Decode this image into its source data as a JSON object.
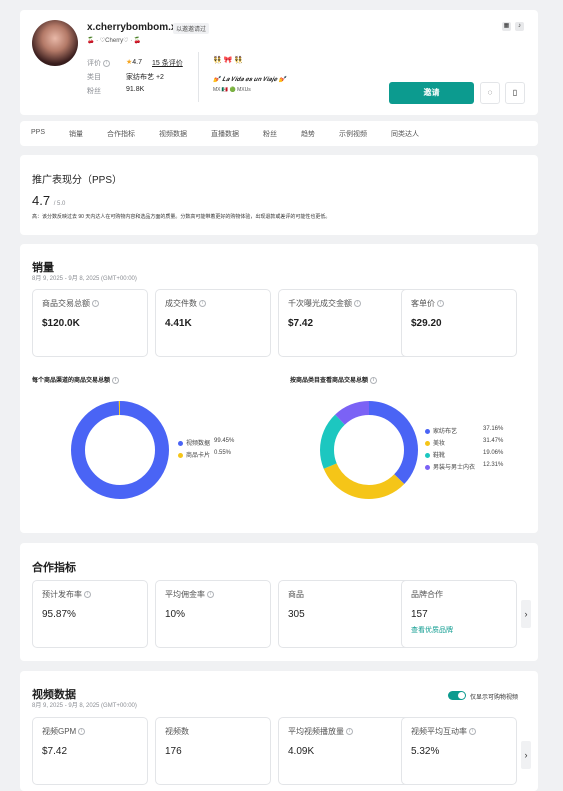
{
  "profile": {
    "username": "x.cherrybombom.x",
    "invite_badge": "以邀邀请过",
    "nickname": "🍒 · ♡Cherry♡ · 🍒",
    "rating_label": "评价",
    "rating_value": "4.7",
    "reviews_link": "15 条评价",
    "category_label": "类目",
    "category_value": "家纺布艺 +2",
    "fans_label": "粉丝",
    "fans_value": "91.8K",
    "bio_emojis": "👯 🎀 👯",
    "bio_line": "💅 𝑳𝒂 𝑽𝒊𝒅𝒂 𝒆𝒔 𝒖𝒏 𝑽𝒊𝒂𝒋𝒆 💅",
    "bio_location": "MX 🇲🇽 🟢 MXUs",
    "invite_button": "邀请",
    "colors": {
      "accent": "#0c9b8f"
    }
  },
  "tabs": [
    "PPS",
    "销量",
    "合作指标",
    "视频数据",
    "直播数据",
    "粉丝",
    "趋势",
    "示例视频",
    "同类达人"
  ],
  "pps": {
    "title": "推广表现分（PPS）",
    "score": "4.7",
    "score_max": "/ 5.0",
    "description": "高：该分数反映过去 90 天内达人在可购物内容和选品方面的质量。分数高可能带着更好的购物体验，出现退款或差评的可能性也更低。"
  },
  "sales": {
    "title": "销量",
    "date_range": "8月 9, 2025 - 9月 8, 2025 (GMT+00:00)",
    "stats": [
      {
        "label": "商品交易总额",
        "value": "$120.0K"
      },
      {
        "label": "成交件数",
        "value": "4.41K"
      },
      {
        "label": "千次曝光成交金额",
        "value": "$7.42"
      },
      {
        "label": "客单价",
        "value": "$29.20"
      }
    ],
    "chart_left_title": "每个商品渠道的商品交易总额",
    "chart_right_title": "按商品类目查看商品交易总额"
  },
  "chart_data": [
    {
      "type": "pie",
      "title": "每个商品渠道的商品交易总额",
      "categories": [
        "视频数据",
        "商品卡片"
      ],
      "values": [
        99.45,
        0.55
      ],
      "value_labels": [
        "99.45%",
        "0.55%"
      ],
      "colors": [
        "#4a64f5",
        "#f5c518"
      ],
      "legend": "right"
    },
    {
      "type": "pie",
      "title": "按商品类目查看商品交易总额",
      "categories": [
        "家纺布艺",
        "美妆",
        "鞋靴",
        "男装与男士内衣"
      ],
      "values": [
        37.16,
        31.47,
        19.06,
        12.31
      ],
      "value_labels": [
        "37.16%",
        "31.47%",
        "19.06%",
        "12.31%"
      ],
      "colors": [
        "#4a64f5",
        "#f5c518",
        "#1cc7c0",
        "#7b62f5"
      ],
      "legend": "right"
    }
  ],
  "coop": {
    "title": "合作指标",
    "stats": [
      {
        "label": "预计发布率",
        "value": "95.87%"
      },
      {
        "label": "平均佣金率",
        "value": "10%"
      },
      {
        "label": "商品",
        "value": "305"
      },
      {
        "label": "品牌合作",
        "value": "157"
      }
    ],
    "link": "查看优质品牌",
    "arrow": "›"
  },
  "video": {
    "title": "视频数据",
    "date_range": "8月 9, 2025 - 9月 8, 2025 (GMT+00:00)",
    "toggle_label": "仅显示可购物视频",
    "toggle_on": true,
    "stats": [
      {
        "label": "视频GPM",
        "value": "$7.42"
      },
      {
        "label": "视频数",
        "value": "176"
      },
      {
        "label": "平均视频播放量",
        "value": "4.09K"
      },
      {
        "label": "视频平均互动率",
        "value": "5.32%"
      }
    ],
    "arrow": "›"
  }
}
